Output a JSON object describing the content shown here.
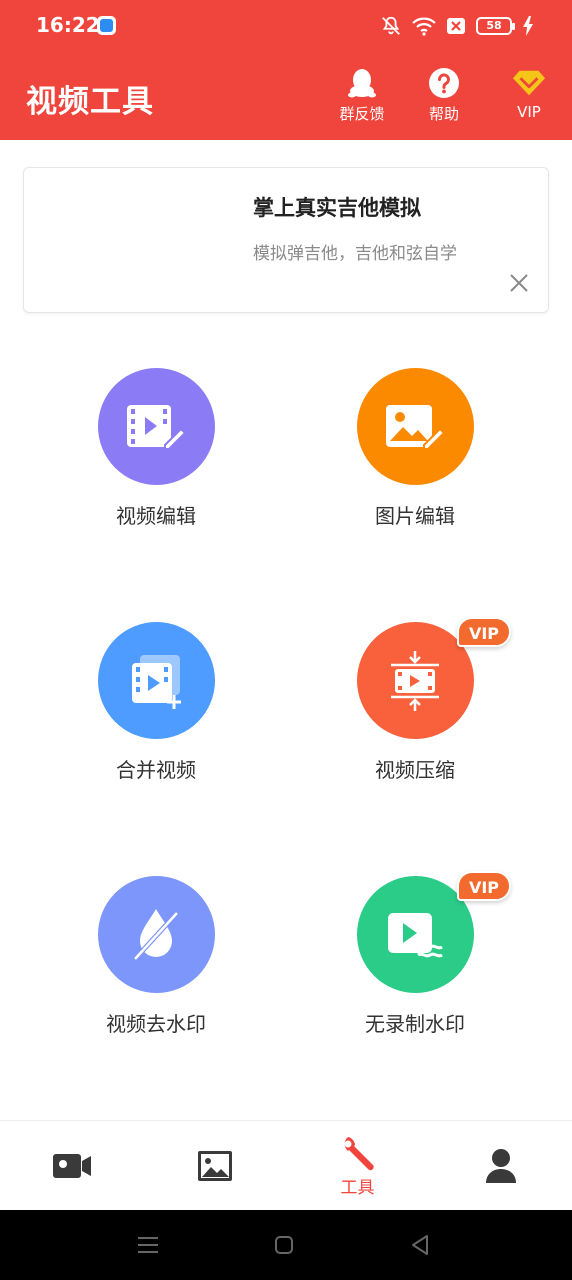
{
  "status_bar": {
    "time": "16:22",
    "battery": "58"
  },
  "app_bar": {
    "title": "视频工具",
    "feedback_label": "群反馈",
    "help_label": "帮助",
    "vip_label": "VIP"
  },
  "banner": {
    "title": "掌上真实吉他模拟",
    "subtitle": "模拟弹吉他，吉他和弦自学"
  },
  "tools": [
    {
      "label": "视频编辑",
      "icon": "video-edit-icon",
      "color": "#8b7cf6",
      "vip": false
    },
    {
      "label": "图片编辑",
      "icon": "image-edit-icon",
      "color": "#fb8a00",
      "vip": false
    },
    {
      "label": "合并视频",
      "icon": "merge-video-icon",
      "color": "#4e9cff",
      "vip": false
    },
    {
      "label": "视频压缩",
      "icon": "compress-video-icon",
      "color": "#f8613c",
      "vip": true
    },
    {
      "label": "视频去水印",
      "icon": "remove-watermark-icon",
      "color": "#7c96fb",
      "vip": false
    },
    {
      "label": "无录制水印",
      "icon": "no-watermark-record-icon",
      "color": "#2bcb88",
      "vip": true
    }
  ],
  "vip_badge_label": "VIP",
  "bottom_nav": {
    "items": [
      {
        "icon": "video-camera-icon",
        "label": ""
      },
      {
        "icon": "picture-icon",
        "label": ""
      },
      {
        "icon": "wrench-icon",
        "label": "工具",
        "active": true
      },
      {
        "icon": "user-icon",
        "label": ""
      }
    ]
  },
  "colors": {
    "primary": "#f0453c",
    "vip_badge": "#f26a2e",
    "vip_gold": "#f5c518",
    "nav_inactive": "#3a3a3a"
  }
}
